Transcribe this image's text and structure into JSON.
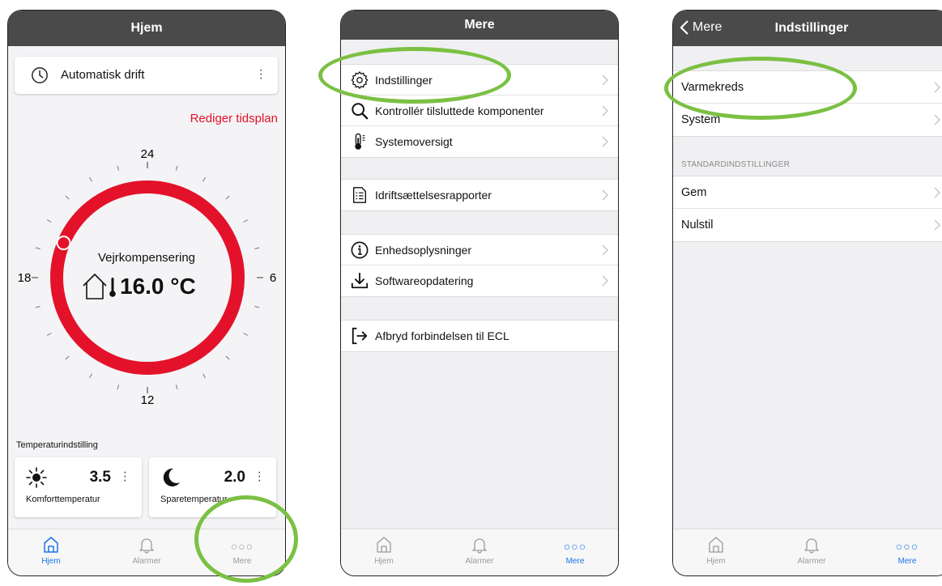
{
  "panel_home": {
    "header_title": "Hjem",
    "mode_label": "Automatisk drift",
    "edit_schedule": "Rediger tidsplan",
    "dial": {
      "top_label": "24",
      "right_label": "6",
      "bottom_label": "12",
      "left_label": "18",
      "mode_title": "Vejrkompensering",
      "temperature": "16.0 °C"
    },
    "temp_setting_label": "Temperaturindstilling",
    "cards": [
      {
        "value": "3.5",
        "name": "Komforttemperatur",
        "icon": "sun-icon"
      },
      {
        "value": "2.0",
        "name": "Sparetemperatur",
        "icon": "moon-icon"
      }
    ]
  },
  "panel_more": {
    "header_title": "Mere",
    "groups": [
      {
        "items": [
          {
            "label": "Indstillinger",
            "icon": "gear-icon"
          },
          {
            "label": "Kontrollér tilsluttede komponenter",
            "icon": "magnifier-icon"
          },
          {
            "label": "Systemoversigt",
            "icon": "thermometer-icon"
          }
        ]
      },
      {
        "items": [
          {
            "label": "Idriftsættelsesrapporter",
            "icon": "report-icon"
          }
        ]
      },
      {
        "items": [
          {
            "label": "Enhedsoplysninger",
            "icon": "info-icon"
          },
          {
            "label": "Softwareopdatering",
            "icon": "download-icon"
          }
        ]
      },
      {
        "items": [
          {
            "label": "Afbryd forbindelsen til ECL",
            "icon": "logout-icon"
          }
        ]
      }
    ]
  },
  "panel_settings": {
    "back_label": "Mere",
    "header_title": "Indstillinger",
    "items": [
      {
        "label": "Varmekreds"
      },
      {
        "label": "System"
      }
    ],
    "section_header": "STANDARDINDSTILLINGER",
    "std_items": [
      {
        "label": "Gem"
      },
      {
        "label": "Nulstil"
      }
    ]
  },
  "tabs": [
    {
      "label": "Hjem",
      "icon": "home-icon"
    },
    {
      "label": "Alarmer",
      "icon": "bell-icon"
    },
    {
      "label": "Mere",
      "icon": "more-dots-icon"
    }
  ],
  "colors": {
    "header": "#4a4a4a",
    "accent_red": "#e3122a",
    "tab_active": "#1a73e8",
    "highlight_green": "#7bc043"
  },
  "dial_setpoint_hour": 19.5
}
